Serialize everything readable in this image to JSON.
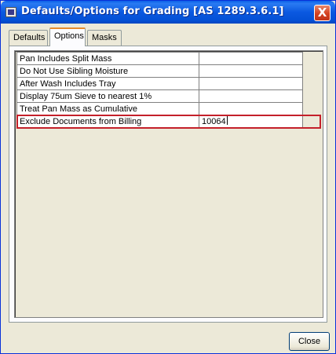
{
  "window": {
    "title": "Defaults/Options for Grading [AS 1289.3.6.1]",
    "title_icon": "app-icon",
    "close_glyph": "X"
  },
  "tabs": [
    {
      "label": "Defaults",
      "active": false
    },
    {
      "label": "Options",
      "active": true
    },
    {
      "label": "Masks",
      "active": false
    }
  ],
  "options": [
    {
      "label": "Pan Includes Split Mass",
      "value": ""
    },
    {
      "label": "Do Not Use Sibling Moisture",
      "value": ""
    },
    {
      "label": "After Wash Includes Tray",
      "value": ""
    },
    {
      "label": "Display 75um Sieve to nearest 1%",
      "value": ""
    },
    {
      "label": "Treat Pan Mass as Cumulative",
      "value": ""
    },
    {
      "label": "Exclude Documents from Billing",
      "value": "10064",
      "selected": true
    }
  ],
  "footer": {
    "close_label": "Close"
  },
  "colors": {
    "titlebar": "#0450d6",
    "selection_outline": "#c4202a",
    "active_tab_accent": "#e68b2c"
  }
}
